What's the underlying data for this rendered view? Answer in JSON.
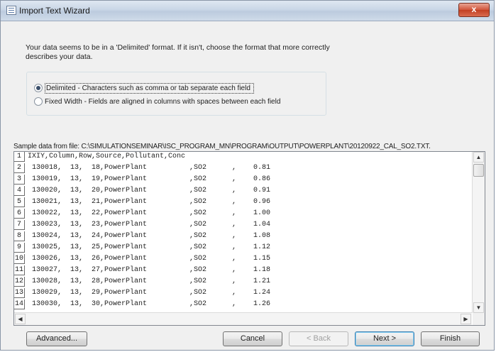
{
  "window": {
    "title": "Import Text Wizard",
    "close_glyph": "x"
  },
  "intro": "Your data seems to be in a 'Delimited' format. If it isn't, choose the format that more correctly describes your data.",
  "options": [
    {
      "label": "Delimited - Characters such as comma or tab separate each field",
      "selected": true
    },
    {
      "label": "Fixed Width - Fields are aligned in columns with spaces between each field",
      "selected": false
    }
  ],
  "sample": {
    "label": "Sample data from file: C:\\SIMULATIONSEMINAR\\ISC_PROGRAM_MN\\PROGRAM\\OUTPUT\\POWERPLANT\\20120922_CAL_SO2.TXT.",
    "rows": [
      {
        "num": "1",
        "text": "IXIY,Column,Row,Source,Pollutant,Conc"
      },
      {
        "num": "2",
        "text": " 130018,  13,  18,PowerPlant          ,SO2      ,    0.81"
      },
      {
        "num": "3",
        "text": " 130019,  13,  19,PowerPlant          ,SO2      ,    0.86"
      },
      {
        "num": "4",
        "text": " 130020,  13,  20,PowerPlant          ,SO2      ,    0.91"
      },
      {
        "num": "5",
        "text": " 130021,  13,  21,PowerPlant          ,SO2      ,    0.96"
      },
      {
        "num": "6",
        "text": " 130022,  13,  22,PowerPlant          ,SO2      ,    1.00"
      },
      {
        "num": "7",
        "text": " 130023,  13,  23,PowerPlant          ,SO2      ,    1.04"
      },
      {
        "num": "8",
        "text": " 130024,  13,  24,PowerPlant          ,SO2      ,    1.08"
      },
      {
        "num": "9",
        "text": " 130025,  13,  25,PowerPlant          ,SO2      ,    1.12"
      },
      {
        "num": "10",
        "text": " 130026,  13,  26,PowerPlant          ,SO2      ,    1.15"
      },
      {
        "num": "11",
        "text": " 130027,  13,  27,PowerPlant          ,SO2      ,    1.18"
      },
      {
        "num": "12",
        "text": " 130028,  13,  28,PowerPlant          ,SO2      ,    1.21"
      },
      {
        "num": "13",
        "text": " 130029,  13,  29,PowerPlant          ,SO2      ,    1.24"
      },
      {
        "num": "14",
        "text": " 130030,  13,  30,PowerPlant          ,SO2      ,    1.26"
      }
    ]
  },
  "buttons": {
    "advanced": "Advanced...",
    "cancel": "Cancel",
    "back": "< Back",
    "next": "Next >",
    "finish": "Finish"
  },
  "icons": {
    "scroll_up": "▲",
    "scroll_down": "▼",
    "scroll_left": "◀",
    "scroll_right": "▶"
  }
}
